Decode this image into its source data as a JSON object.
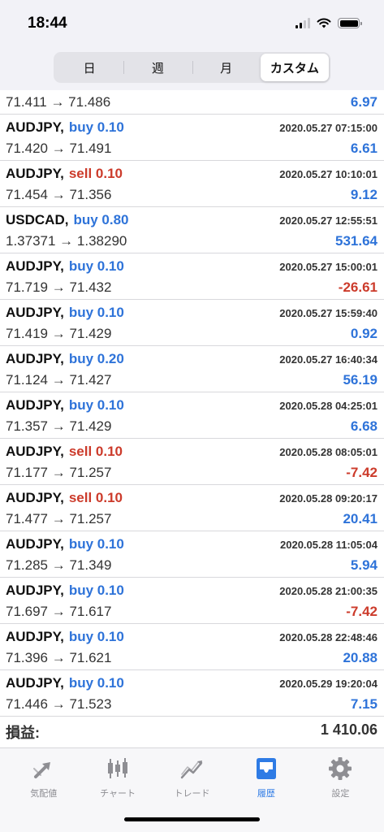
{
  "status_bar": {
    "time": "18:44"
  },
  "segments": [
    {
      "label": "日",
      "active": false
    },
    {
      "label": "週",
      "active": false
    },
    {
      "label": "月",
      "active": false
    },
    {
      "label": "カスタム",
      "active": true
    }
  ],
  "partial_row": {
    "prices": "71.411 → 71.486",
    "profit": "6.97"
  },
  "trades": [
    {
      "symbol": "AUDJPY,",
      "type": "buy 0.10",
      "side": "buy",
      "time": "2020.05.27 07:15:00",
      "prices": "71.420 → 71.491",
      "profit": "6.61"
    },
    {
      "symbol": "AUDJPY,",
      "type": "sell 0.10",
      "side": "sell",
      "time": "2020.05.27 10:10:01",
      "prices": "71.454 → 71.356",
      "profit": "9.12"
    },
    {
      "symbol": "USDCAD,",
      "type": "buy 0.80",
      "side": "buy",
      "time": "2020.05.27 12:55:51",
      "prices": "1.37371 → 1.38290",
      "profit": "531.64"
    },
    {
      "symbol": "AUDJPY,",
      "type": "buy 0.10",
      "side": "buy",
      "time": "2020.05.27 15:00:01",
      "prices": "71.719 → 71.432",
      "profit": "-26.61"
    },
    {
      "symbol": "AUDJPY,",
      "type": "buy 0.10",
      "side": "buy",
      "time": "2020.05.27 15:59:40",
      "prices": "71.419 → 71.429",
      "profit": "0.92"
    },
    {
      "symbol": "AUDJPY,",
      "type": "buy 0.20",
      "side": "buy",
      "time": "2020.05.27 16:40:34",
      "prices": "71.124 → 71.427",
      "profit": "56.19"
    },
    {
      "symbol": "AUDJPY,",
      "type": "buy 0.10",
      "side": "buy",
      "time": "2020.05.28 04:25:01",
      "prices": "71.357 → 71.429",
      "profit": "6.68"
    },
    {
      "symbol": "AUDJPY,",
      "type": "sell 0.10",
      "side": "sell",
      "time": "2020.05.28 08:05:01",
      "prices": "71.177 → 71.257",
      "profit": "-7.42"
    },
    {
      "symbol": "AUDJPY,",
      "type": "sell 0.10",
      "side": "sell",
      "time": "2020.05.28 09:20:17",
      "prices": "71.477 → 71.257",
      "profit": "20.41"
    },
    {
      "symbol": "AUDJPY,",
      "type": "buy 0.10",
      "side": "buy",
      "time": "2020.05.28 11:05:04",
      "prices": "71.285 → 71.349",
      "profit": "5.94"
    },
    {
      "symbol": "AUDJPY,",
      "type": "buy 0.10",
      "side": "buy",
      "time": "2020.05.28 21:00:35",
      "prices": "71.697 → 71.617",
      "profit": "-7.42"
    },
    {
      "symbol": "AUDJPY,",
      "type": "buy 0.10",
      "side": "buy",
      "time": "2020.05.28 22:48:46",
      "prices": "71.396 → 71.621",
      "profit": "20.88"
    },
    {
      "symbol": "AUDJPY,",
      "type": "buy 0.10",
      "side": "buy",
      "time": "2020.05.29 19:20:04",
      "prices": "71.446 → 71.523",
      "profit": "7.15"
    }
  ],
  "summary": {
    "label": "損益:",
    "value": "1 410.06"
  },
  "tabs": [
    {
      "label": "気配値",
      "icon": "quotes-arrows-icon",
      "active": false
    },
    {
      "label": "チャート",
      "icon": "candlestick-chart-icon",
      "active": false
    },
    {
      "label": "トレード",
      "icon": "trade-trend-icon",
      "active": false
    },
    {
      "label": "履歴",
      "icon": "history-tray-icon",
      "active": true
    },
    {
      "label": "設定",
      "icon": "gear-icon",
      "active": false
    }
  ],
  "colors": {
    "buy": "#2e73d9",
    "sell": "#cc3b2b",
    "active_tab": "#2e7be5",
    "inactive_tab": "#8e8e93"
  }
}
